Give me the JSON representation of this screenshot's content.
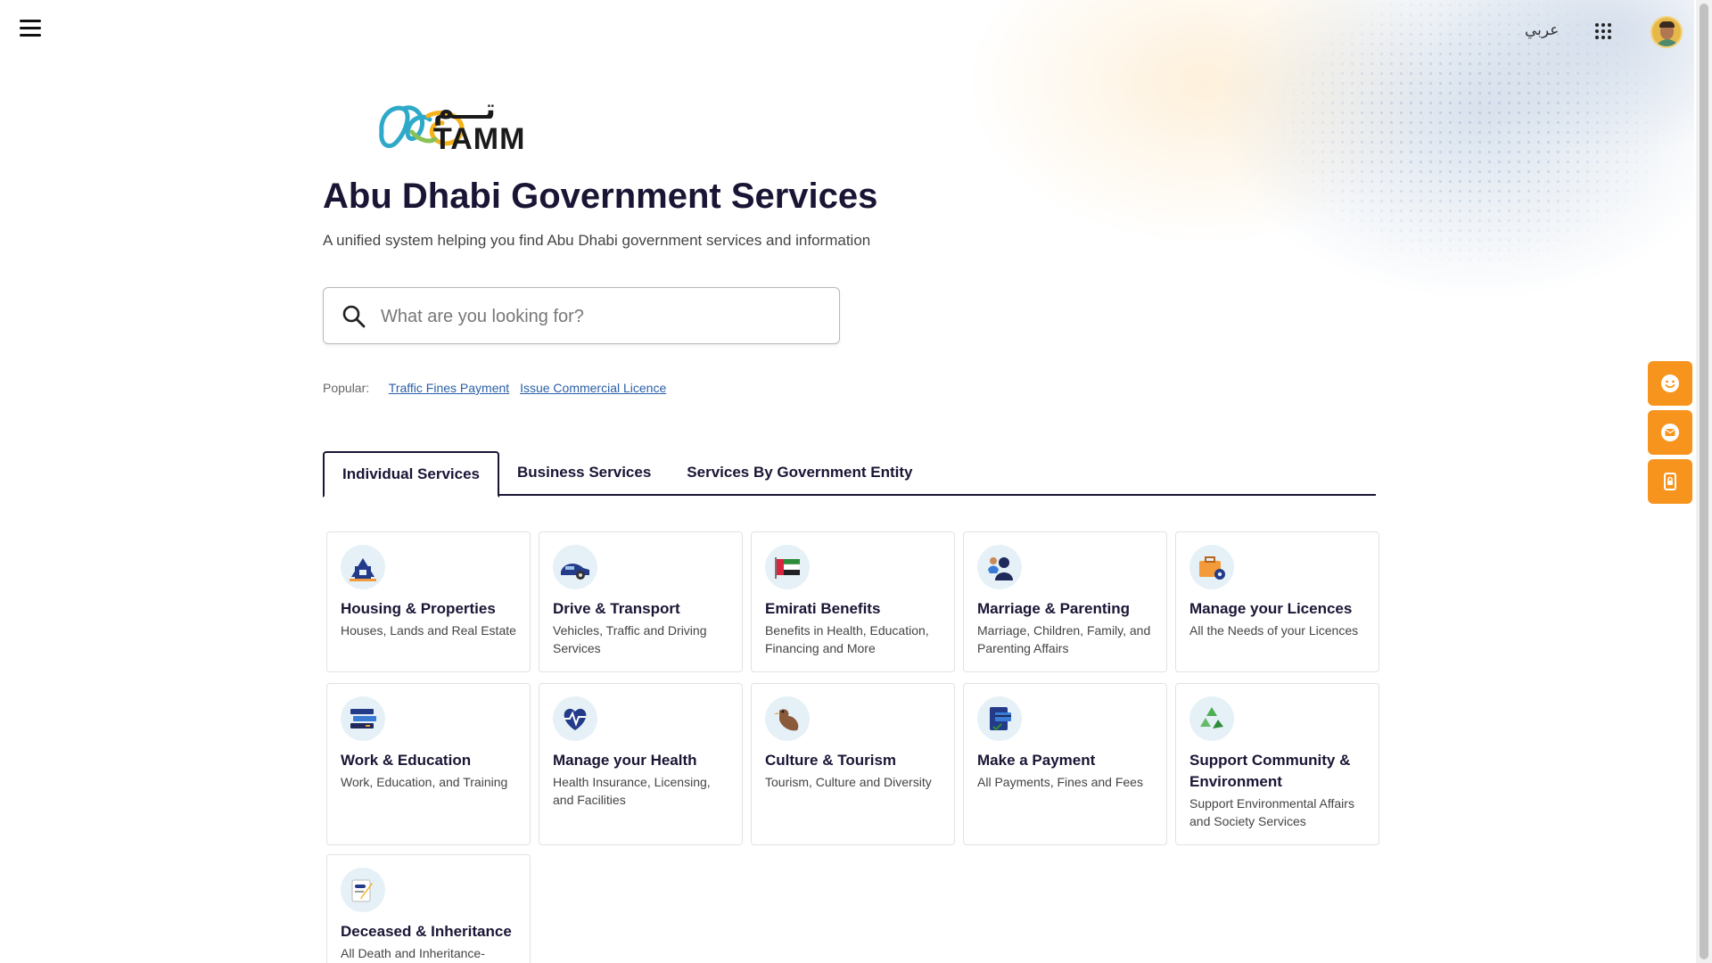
{
  "header": {
    "language_toggle": "عربي",
    "menu_icon": "hamburger-menu-icon",
    "apps_icon": "apps-grid-icon",
    "avatar": "user-avatar"
  },
  "brand": {
    "logo_arabic": "تـــم",
    "logo_latin": "TAMM",
    "logo_colors": [
      "#2fa9c9",
      "#f5b21a"
    ]
  },
  "hero": {
    "title": "Abu Dhabi Government Services",
    "subtitle": "A unified system helping you find Abu Dhabi government services and information"
  },
  "search": {
    "placeholder": "What are you looking for?",
    "value": "",
    "icon": "search-icon"
  },
  "popular": {
    "label": "Popular:",
    "links": [
      "Traffic Fines Payment",
      "Issue Commercial Licence"
    ]
  },
  "tabs": [
    {
      "label": "Individual Services",
      "active": true
    },
    {
      "label": "Business Services",
      "active": false
    },
    {
      "label": "Services By Government Entity",
      "active": false
    }
  ],
  "cards": [
    {
      "title": "Housing & Properties",
      "desc": "Houses, Lands and Real Estate",
      "icon": "house-icon"
    },
    {
      "title": "Drive & Transport",
      "desc": "Vehicles, Traffic and Driving Services",
      "icon": "car-icon"
    },
    {
      "title": "Emirati Benefits",
      "desc": "Benefits in Health, Education, Financing and More",
      "icon": "uae-flag-icon"
    },
    {
      "title": "Marriage & Parenting",
      "desc": "Marriage, Children, Family, and Parenting Affairs",
      "icon": "family-icon"
    },
    {
      "title": "Manage your Licences",
      "desc": "All the Needs of your Licences",
      "icon": "briefcase-gear-icon"
    },
    {
      "title": "Work & Education",
      "desc": "Work, Education, and Training",
      "icon": "books-icon"
    },
    {
      "title": "Manage your Health",
      "desc": "Health Insurance, Licensing, and Facilities",
      "icon": "heart-pulse-icon"
    },
    {
      "title": "Culture & Tourism",
      "desc": "Tourism, Culture and Diversity",
      "icon": "falcon-icon"
    },
    {
      "title": "Make a Payment",
      "desc": "All Payments, Fines and Fees",
      "icon": "payment-card-icon"
    },
    {
      "title": "Support Community & Environment",
      "desc": "Support Environmental Affairs and Society Services",
      "icon": "recycle-icon"
    },
    {
      "title": "Deceased & Inheritance",
      "desc": "All Death and Inheritance-",
      "icon": "document-pen-icon"
    }
  ],
  "floating_actions": [
    {
      "name": "feedback-smiley-icon"
    },
    {
      "name": "message-envelope-icon"
    },
    {
      "name": "mobile-lock-icon"
    }
  ],
  "colors": {
    "accent_orange": "#f7941d",
    "navy": "#1a1535",
    "link_blue": "#2a5fa8"
  }
}
